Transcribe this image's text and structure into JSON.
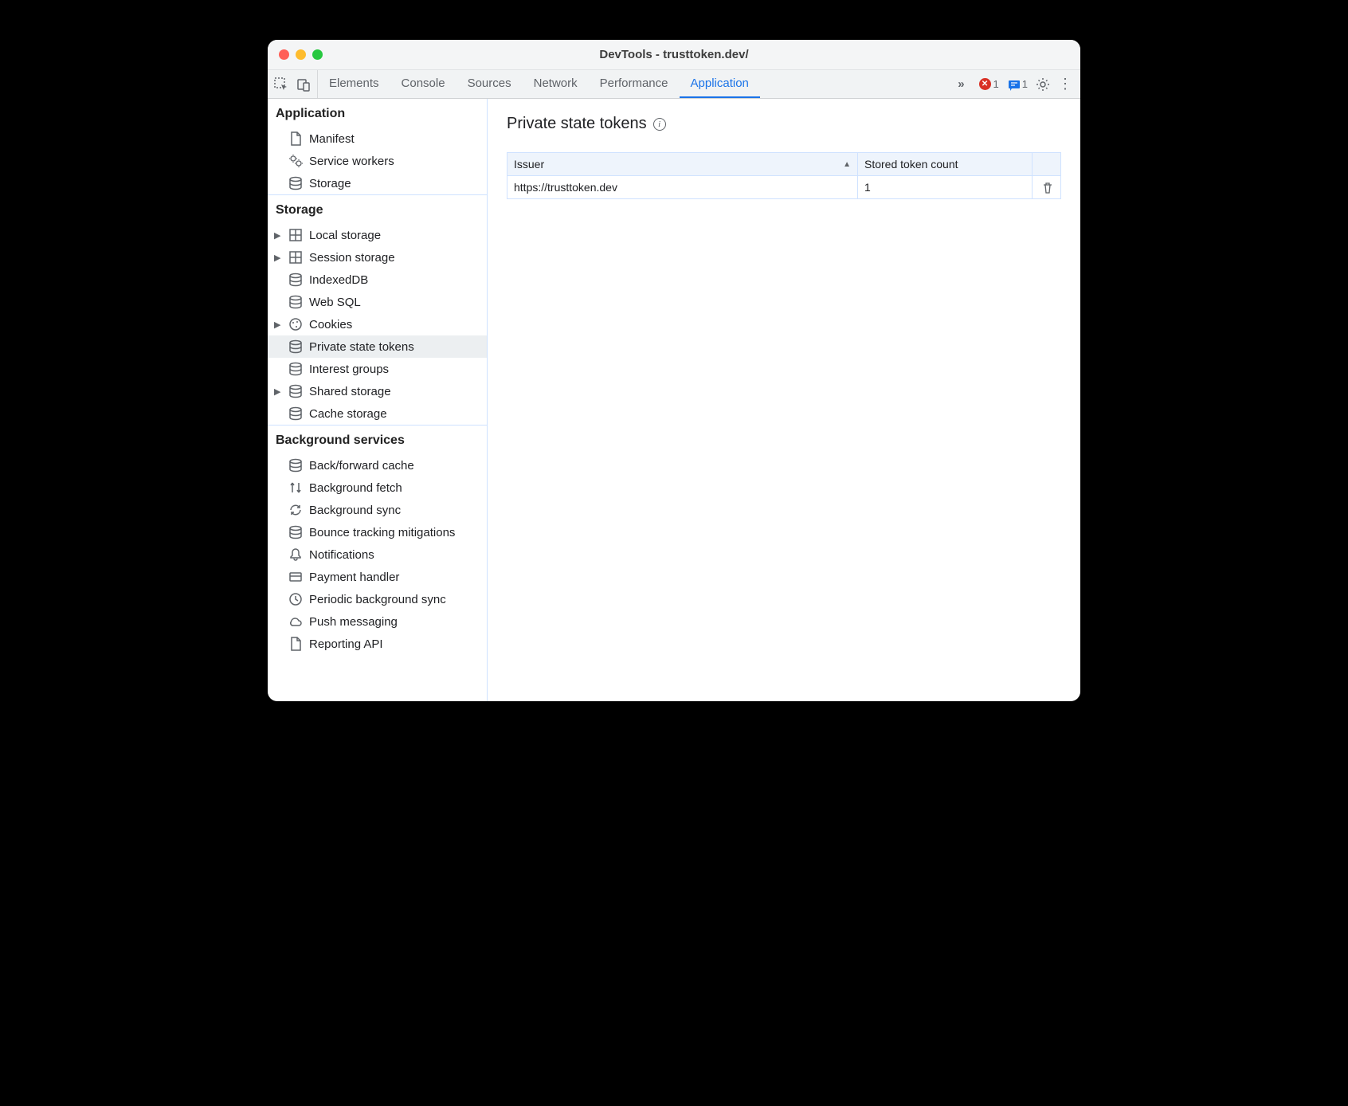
{
  "window": {
    "title": "DevTools - trusttoken.dev/"
  },
  "toolbar": {
    "tabs": [
      {
        "label": "Elements",
        "active": false
      },
      {
        "label": "Console",
        "active": false
      },
      {
        "label": "Sources",
        "active": false
      },
      {
        "label": "Network",
        "active": false
      },
      {
        "label": "Performance",
        "active": false
      },
      {
        "label": "Application",
        "active": true
      }
    ],
    "error_count": "1",
    "message_count": "1"
  },
  "sidebar": {
    "sections": [
      {
        "title": "Application",
        "items": [
          {
            "label": "Manifest",
            "icon": "document",
            "arrow": false
          },
          {
            "label": "Service workers",
            "icon": "gears",
            "arrow": false
          },
          {
            "label": "Storage",
            "icon": "db",
            "arrow": false
          }
        ]
      },
      {
        "title": "Storage",
        "items": [
          {
            "label": "Local storage",
            "icon": "grid",
            "arrow": true
          },
          {
            "label": "Session storage",
            "icon": "grid",
            "arrow": true
          },
          {
            "label": "IndexedDB",
            "icon": "db",
            "arrow": false
          },
          {
            "label": "Web SQL",
            "icon": "db",
            "arrow": false
          },
          {
            "label": "Cookies",
            "icon": "cookie",
            "arrow": true
          },
          {
            "label": "Private state tokens",
            "icon": "db",
            "arrow": false,
            "selected": true
          },
          {
            "label": "Interest groups",
            "icon": "db",
            "arrow": false
          },
          {
            "label": "Shared storage",
            "icon": "db",
            "arrow": true
          },
          {
            "label": "Cache storage",
            "icon": "db",
            "arrow": false
          }
        ]
      },
      {
        "title": "Background services",
        "items": [
          {
            "label": "Back/forward cache",
            "icon": "db",
            "arrow": false
          },
          {
            "label": "Background fetch",
            "icon": "updown",
            "arrow": false
          },
          {
            "label": "Background sync",
            "icon": "sync",
            "arrow": false
          },
          {
            "label": "Bounce tracking mitigations",
            "icon": "db",
            "arrow": false
          },
          {
            "label": "Notifications",
            "icon": "bell",
            "arrow": false
          },
          {
            "label": "Payment handler",
            "icon": "card",
            "arrow": false
          },
          {
            "label": "Periodic background sync",
            "icon": "clock",
            "arrow": false
          },
          {
            "label": "Push messaging",
            "icon": "cloud",
            "arrow": false
          },
          {
            "label": "Reporting API",
            "icon": "document",
            "arrow": false
          }
        ]
      }
    ]
  },
  "main": {
    "title": "Private state tokens",
    "table": {
      "columns": [
        {
          "label": "Issuer",
          "sorted": true
        },
        {
          "label": "Stored token count",
          "sorted": false
        }
      ],
      "rows": [
        {
          "issuer": "https://trusttoken.dev",
          "count": "1"
        }
      ]
    }
  }
}
